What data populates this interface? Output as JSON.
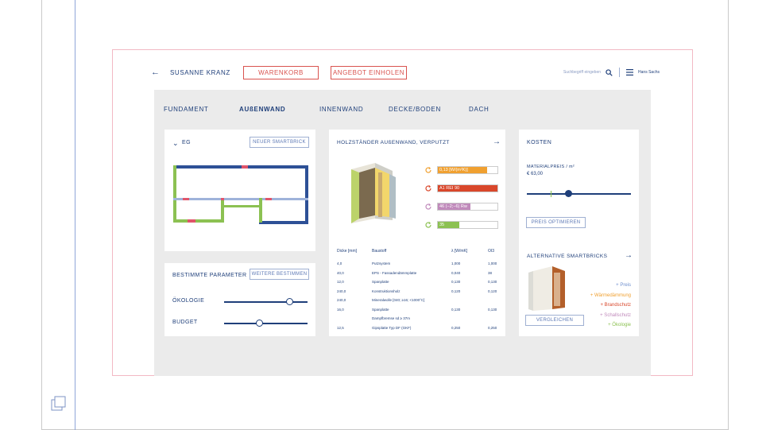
{
  "header": {
    "user_name": "SUSANNE KRANZ",
    "cart_label": "WARENKORB",
    "offer_label": "ANGEBOT EINHOLEN",
    "search_placeholder": "Suchbegriff eingeben",
    "account_name": "Hans Sachs"
  },
  "tabs": [
    {
      "label": "FUNDAMENT",
      "active": false
    },
    {
      "label": "AUßENWAND",
      "active": true
    },
    {
      "label": "INNENWAND",
      "active": false
    },
    {
      "label": "DECKE/BODEN",
      "active": false
    },
    {
      "label": "DACH",
      "active": false
    }
  ],
  "floor_card": {
    "title": "EG",
    "new_button": "NEUER SMARTBRICK"
  },
  "params_card": {
    "title": "BESTIMMTE PARAMETER",
    "more_button": "WEITERE BESTIMMEN",
    "sliders": [
      {
        "label": "ÖKOLOGIE",
        "value": 0.78
      },
      {
        "label": "BUDGET",
        "value": 0.42
      }
    ]
  },
  "wall_card": {
    "title": "HOLZSTÄNDER AUßENWAND, VERPUTZT",
    "properties": [
      {
        "text": "0,13 [W/(m²K)]",
        "fill": 0.82,
        "color": "#f0a030",
        "extra": ""
      },
      {
        "text": "A1 REI 90",
        "fill": 1.0,
        "color": "#d9472b",
        "extra": ""
      },
      {
        "text": "46 (−2;−6) Rw",
        "fill": 0.55,
        "color": "#c08abb",
        "extra": "(−2;−6)"
      },
      {
        "text": "35",
        "fill": 0.36,
        "color": "#8cc152",
        "extra": ""
      }
    ],
    "table": {
      "headers": [
        "Dicke [mm]",
        "Baustoff",
        "λ [W/mK]",
        "OI3"
      ],
      "rows": [
        [
          "4,0",
          "Putzsystem",
          "1,000",
          "1,000"
        ],
        [
          "40,0",
          "EPS - Fassadendämmplatte",
          "0,040",
          "38"
        ],
        [
          "12,0",
          "Spanplatte",
          "0,130",
          "0,130"
        ],
        [
          "240,0",
          "Konstruktionsholz",
          "0,120",
          "0,120"
        ],
        [
          "240,0",
          "Mineralwolle [040; ≥16; <1000°C]",
          "",
          ""
        ],
        [
          "16,0",
          "Spanplatte",
          "0,130",
          "0,130"
        ],
        [
          "",
          "Dampfbremse sd ≥ 37m",
          "",
          ""
        ],
        [
          "12,5",
          "Gipsplatte Typ DF (GKF)",
          "0,250",
          "0,250"
        ]
      ]
    }
  },
  "costs_card": {
    "title": "KOSTEN",
    "material_label": "MATERIALPREIS / m²",
    "material_value": "€ 63,00",
    "price_slider": 0.4,
    "optimize_button": "PREIS OPTIMIEREN",
    "alternatives_title": "ALTERNATIVE SMARTBRICKS",
    "alternatives": [
      {
        "label": "+ Preis",
        "color": "#6f8fce"
      },
      {
        "label": "+ Wärmedämmung",
        "color": "#f0a030"
      },
      {
        "label": "+ Brandschutz",
        "color": "#d9472b"
      },
      {
        "label": "+ Schallschutz",
        "color": "#c08abb"
      },
      {
        "label": "+ Ökologie",
        "color": "#8cc152"
      }
    ],
    "compare_button": "VERGLEICHEN"
  },
  "colors": {
    "primary": "#1f3f7a",
    "accent_red": "#d9534f",
    "wall_blue": "#2d5096",
    "wall_green": "#8cc152",
    "wall_light": "#9fb3da",
    "door_red": "#e0556a"
  }
}
